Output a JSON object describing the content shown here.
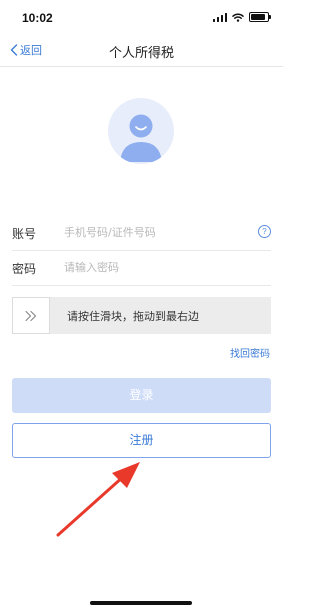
{
  "status_bar": {
    "time": "10:02",
    "battery_level": 0.9,
    "icons": [
      "signal-icon",
      "wifi-icon",
      "battery-icon"
    ]
  },
  "nav": {
    "back_label": "返回",
    "title": "个人所得税"
  },
  "avatar": {
    "icon": "user-avatar-icon"
  },
  "account": {
    "label": "账号",
    "placeholder": "手机号码/证件号码",
    "value": ""
  },
  "password": {
    "label": "密码",
    "placeholder": "请输入密码",
    "value": ""
  },
  "slider": {
    "text": "请按住滑块，拖动到最右边",
    "icon": "double-chevron-right-icon"
  },
  "forgot_password": "找回密码",
  "login_button": "登录",
  "register_button": "注册",
  "colors": {
    "accent": "#3a7bd5",
    "login_disabled": "#cfdcf8",
    "annotation_arrow": "#e8392b"
  }
}
